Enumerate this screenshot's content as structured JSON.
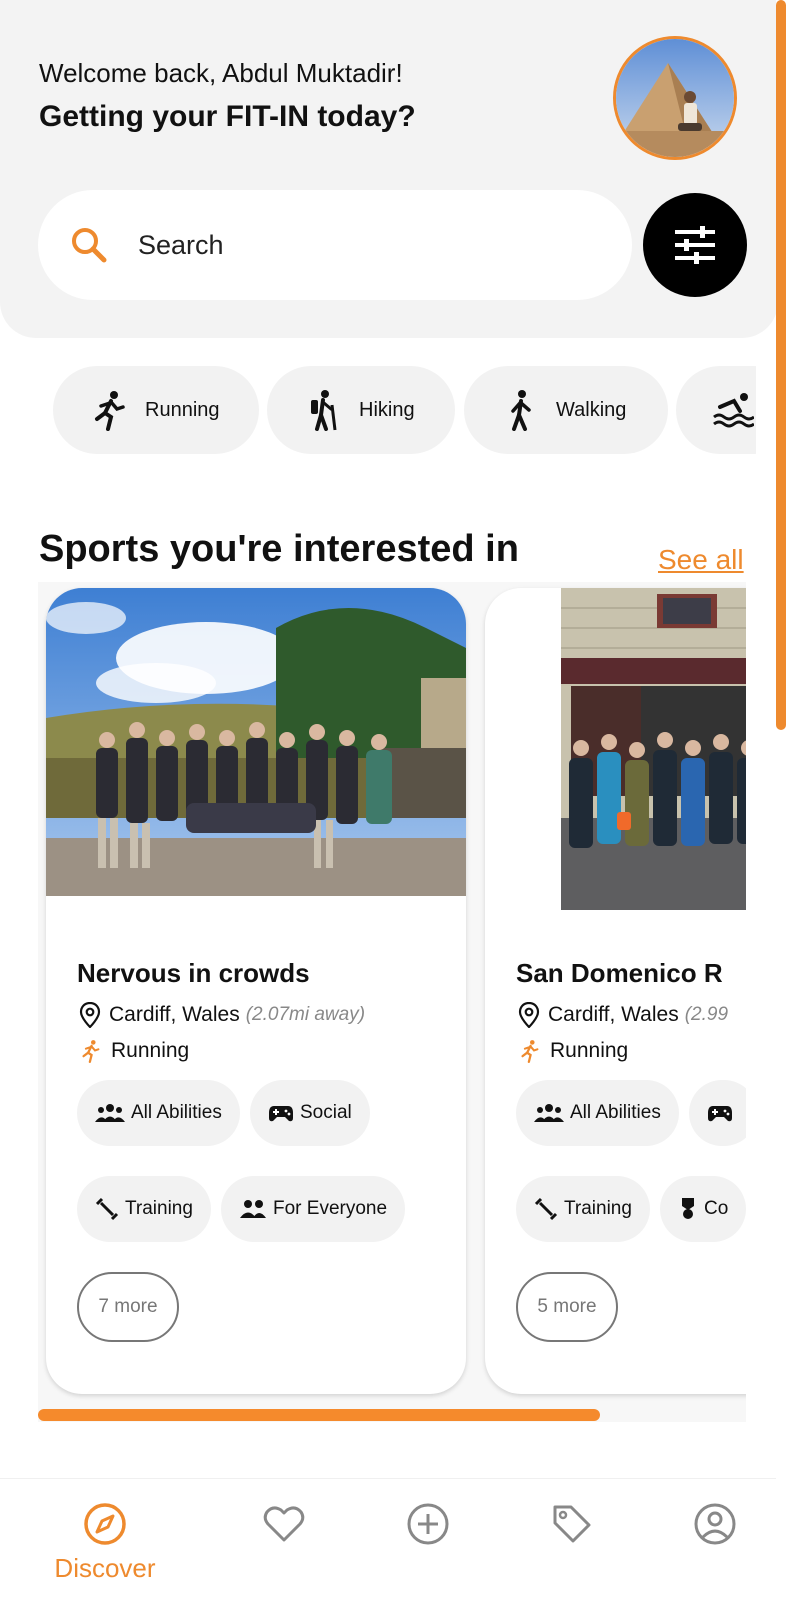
{
  "header": {
    "welcome": "Welcome back, Abdul Muktadir!",
    "tagline": "Getting your FIT-IN today?"
  },
  "search": {
    "placeholder": "Search"
  },
  "activities": [
    {
      "label": "Running",
      "icon": "running-icon"
    },
    {
      "label": "Hiking",
      "icon": "hiking-icon"
    },
    {
      "label": "Walking",
      "icon": "walking-icon"
    },
    {
      "label": "",
      "icon": "swimming-icon"
    }
  ],
  "section": {
    "title": "Sports you're interested in",
    "see_all": "See all"
  },
  "cards": [
    {
      "title": "Nervous in crowds",
      "location": "Cardiff, Wales",
      "distance": "(2.07mi away)",
      "sport": "Running",
      "tags": [
        "All Abilities",
        "Social",
        "Training",
        "For Everyone"
      ],
      "more": "7 more"
    },
    {
      "title": "San Domenico R",
      "location": "Cardiff, Wales",
      "distance": "(2.99",
      "sport": "Running",
      "tags": [
        "All Abilities",
        "",
        "Training",
        "Co"
      ],
      "more": "5 more"
    }
  ],
  "nav": {
    "discover_label": "Discover",
    "active": "Discover"
  },
  "colors": {
    "accent": "#ee8a2e",
    "panel": "#f3f3f3",
    "chip": "#f2f2f2"
  }
}
